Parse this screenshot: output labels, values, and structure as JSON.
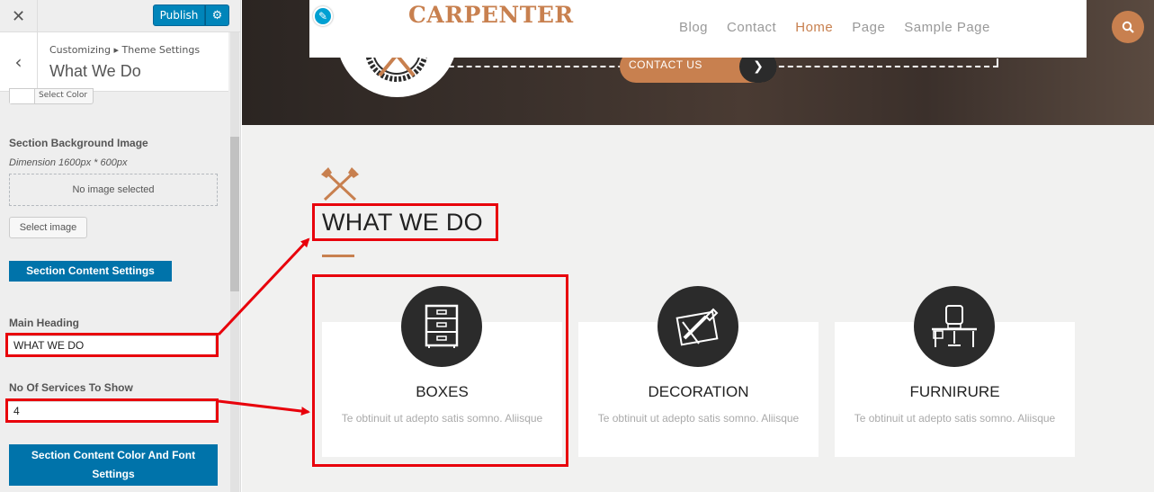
{
  "customizer": {
    "publish_label": "Publish",
    "breadcrumb": "Customizing ▸ Theme Settings",
    "panel_title": "What We Do",
    "select_color_label": "Select Color",
    "bg_image_label": "Section Background Image",
    "bg_image_dimension": "Dimension 1600px * 600px",
    "no_image_text": "No image selected",
    "select_image_label": "Select image",
    "content_settings_label": "Section Content Settings",
    "main_heading_label": "Main Heading",
    "main_heading_value": "WHAT WE DO",
    "services_count_label": "No Of Services To Show",
    "services_count_value": "4",
    "color_font_settings_label": "Section Content Color And Font Settings"
  },
  "site": {
    "logo_text": "CARPENTER",
    "nav": [
      "Blog",
      "Contact",
      "Home",
      "Page",
      "Sample Page"
    ],
    "active_nav": "Home",
    "contact_button": "CONTACT US",
    "section_heading": "WHAT WE DO",
    "services": [
      {
        "title": "BOXES",
        "desc": "Te obtinuit ut adepto satis somno. Aliisque",
        "icon": "drawers-icon"
      },
      {
        "title": "DECORATION",
        "desc": "Te obtinuit ut adepto satis somno. Aliisque",
        "icon": "ruler-pencil-icon"
      },
      {
        "title": "FURNIRURE",
        "desc": "Te obtinuit ut adepto satis somno. Aliisque",
        "icon": "chair-desk-icon"
      }
    ]
  },
  "colors": {
    "accent": "#c8804f",
    "wp_blue": "#0073aa",
    "annotation_red": "#e8000b",
    "dark_circle": "#2b2b2b"
  }
}
